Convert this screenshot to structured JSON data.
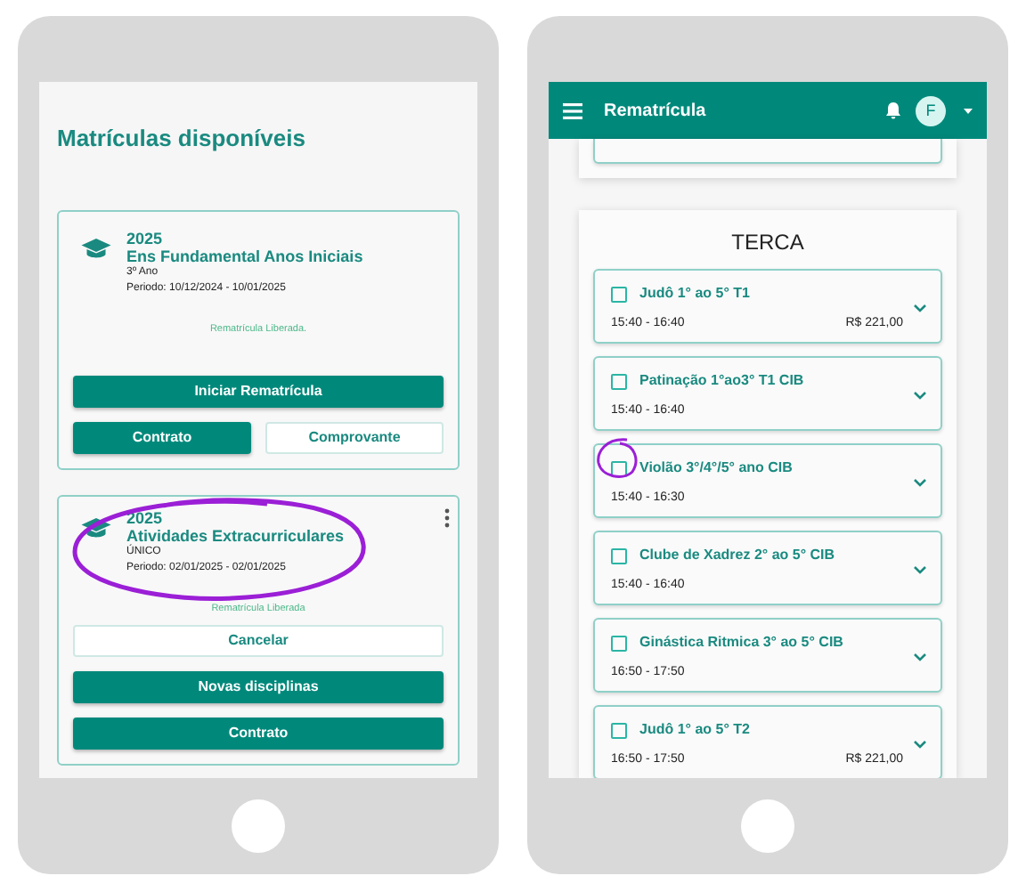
{
  "left_screen": {
    "title": "Matrículas disponíveis",
    "enrollments": [
      {
        "year": "2025",
        "course": "Ens Fundamental Anos Iniciais",
        "grade": "3º Ano",
        "period": "Periodo: 10/12/2024 - 10/01/2025",
        "status": "Rematrícula Liberada.",
        "has_menu": false,
        "button_rows": [
          [
            {
              "label": "Iniciar Rematrícula",
              "kind": "filled"
            }
          ],
          [
            {
              "label": "Contrato",
              "kind": "filled"
            },
            {
              "label": "Comprovante",
              "kind": "outline"
            }
          ]
        ]
      },
      {
        "year": "2025",
        "course": "Atividades Extracurriculares",
        "grade": "ÚNICO",
        "period": "Periodo: 02/01/2025 - 02/01/2025",
        "status": "Rematrícula Liberada",
        "has_menu": true,
        "button_rows": [
          [
            {
              "label": "Cancelar",
              "kind": "outline"
            }
          ],
          [
            {
              "label": "Novas disciplinas",
              "kind": "filled"
            }
          ],
          [
            {
              "label": "Contrato",
              "kind": "filled"
            }
          ]
        ]
      }
    ]
  },
  "right_screen": {
    "app_bar": {
      "title": "Rematrícula",
      "avatar": "F"
    },
    "day_section": {
      "day": "TERCA",
      "activities": [
        {
          "name": "Judô 1° ao 5° T1",
          "time": "15:40 - 16:40",
          "price": "R$ 221,00",
          "checked": false
        },
        {
          "name": "Patinação 1°ao3° T1 CIB",
          "time": "15:40 - 16:40",
          "checked": false
        },
        {
          "name": "Violão 3°/4°/5° ano CIB",
          "time": "15:40 - 16:30",
          "checked": false
        },
        {
          "name": "Clube de Xadrez 2° ao 5° CIB",
          "time": "15:40 - 16:40",
          "checked": false
        },
        {
          "name": "Ginástica Ritmica 3° ao 5° CIB",
          "time": "16:50 - 17:50",
          "checked": false
        },
        {
          "name": "Judô 1° ao 5° T2",
          "time": "16:50 - 17:50",
          "price": "R$ 221,00",
          "checked": false
        }
      ]
    }
  }
}
